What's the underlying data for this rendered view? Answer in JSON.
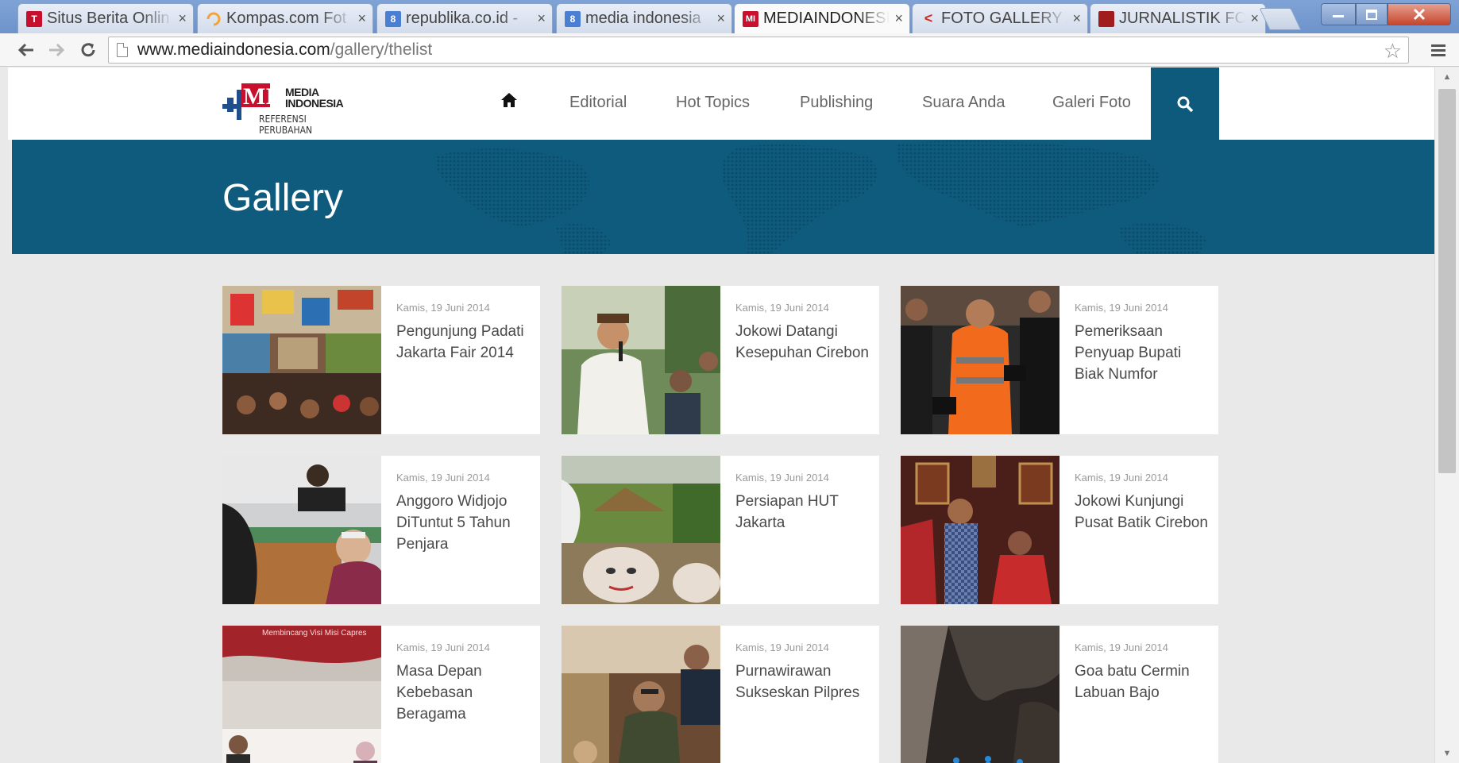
{
  "browser": {
    "tabs": [
      {
        "title": "Situs Berita Onlin",
        "favicon": "T",
        "favicon_color": "#c8102e"
      },
      {
        "title": "Kompas.com Fot",
        "favicon": "",
        "favicon_color": "#f2a33a"
      },
      {
        "title": "republika.co.id - ",
        "favicon": "8",
        "favicon_color": "#4a7fd4"
      },
      {
        "title": "media indonesia",
        "favicon": "8",
        "favicon_color": "#4a7fd4"
      },
      {
        "title": "MEDIAINDONESI",
        "favicon": "MI",
        "favicon_color": "#c8102e"
      },
      {
        "title": "FOTO GALLERY A",
        "favicon": "<",
        "favicon_color": "#d52b1e"
      },
      {
        "title": "JURNALISTIK FOT",
        "favicon": "",
        "favicon_color": "#a11d1d"
      }
    ],
    "active_tab_index": 4,
    "tab_close_glyph": "×",
    "url_host": "www.mediaindonesia.com",
    "url_path": "/gallery/thelist"
  },
  "site": {
    "logo": {
      "line1": "MEDIA",
      "line2": "INDONESIA",
      "mark": "MI",
      "tagline": "REFERENSI PERUBAHAN"
    },
    "nav": [
      "Editorial",
      "Hot Topics",
      "Publishing",
      "Suara Anda",
      "Galeri Foto"
    ],
    "accent_color": "#0f5b7d",
    "banner_title": "Gallery"
  },
  "gallery": [
    {
      "date": "Kamis, 19 Juni 2014",
      "title": "Pengunjung Padati Jakarta Fair 2014"
    },
    {
      "date": "Kamis, 19 Juni 2014",
      "title": "Jokowi Datangi Kesepuhan Cirebon"
    },
    {
      "date": "Kamis, 19 Juni 2014",
      "title": "Pemeriksaan Penyuap Bupati Biak Numfor"
    },
    {
      "date": "Kamis, 19 Juni 2014",
      "title": "Anggoro Widjojo DiTuntut 5 Tahun Penjara"
    },
    {
      "date": "Kamis, 19 Juni 2014",
      "title": "Persiapan HUT Jakarta"
    },
    {
      "date": "Kamis, 19 Juni 2014",
      "title": "Jokowi Kunjungi Pusat Batik Cirebon"
    },
    {
      "date": "Kamis, 19 Juni 2014",
      "title": "Masa Depan Kebebasan Beragama"
    },
    {
      "date": "Kamis, 19 Juni 2014",
      "title": "Purnawirawan Sukseskan Pilpres"
    },
    {
      "date": "Kamis, 19 Juni 2014",
      "title": "Goa batu Cermin Labuan Bajo"
    }
  ],
  "banner_thumb_text": "Membincang Visi Misi Capres"
}
